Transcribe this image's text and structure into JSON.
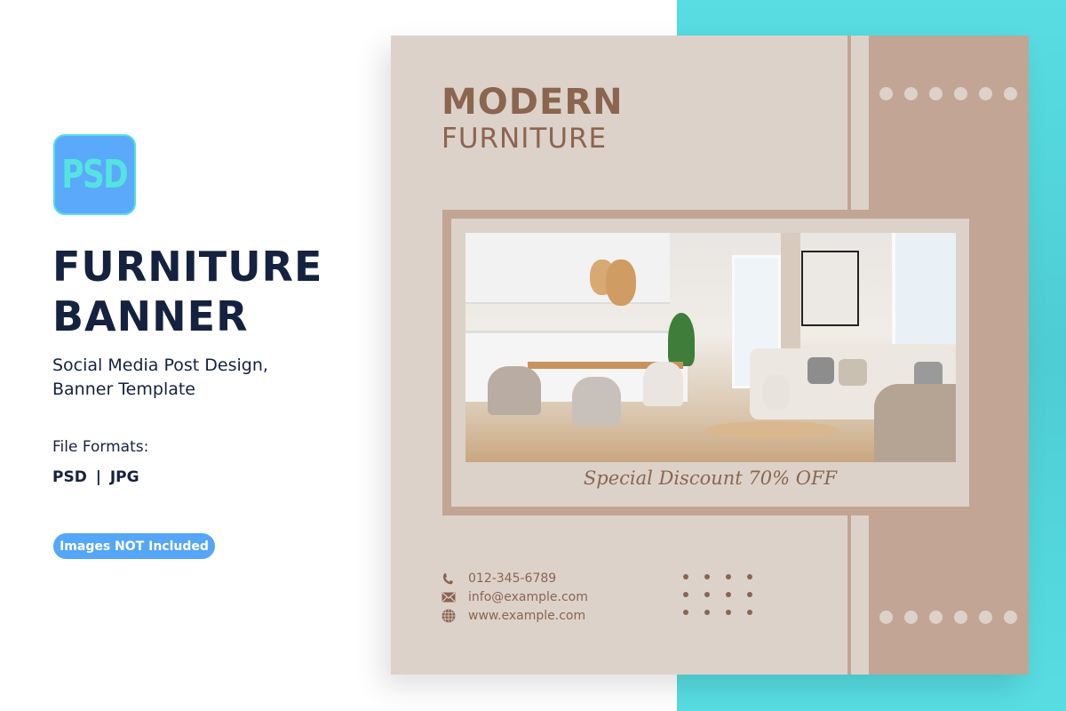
{
  "left_panel": {
    "icon_label": "PSD",
    "title_line1": "FURNITURE",
    "title_line2": "BANNER",
    "subtitle_line1": "Social Media Post Design,",
    "subtitle_line2": "Banner Template",
    "formats_label": "File Formats:",
    "formats": "PSD | JPG",
    "badge": "Images NOT Included"
  },
  "banner": {
    "heading_line1": "MODERN",
    "heading_line2": "FURNITURE",
    "photo_description": "modern living room and dining interior",
    "discount": "Special Discount 70% OFF",
    "contact": [
      {
        "icon": "phone-icon",
        "text": "012-345-6789"
      },
      {
        "icon": "mail-icon",
        "text": "info@example.com"
      },
      {
        "icon": "globe-icon",
        "text": "www.example.com"
      }
    ]
  },
  "colors": {
    "navy": "#15223f",
    "accent_blue": "#55a6f7",
    "teal": "#55dadf",
    "card_beige": "#ddd2c9",
    "card_brown": "#c2a594",
    "text_brown": "#8b6550"
  }
}
